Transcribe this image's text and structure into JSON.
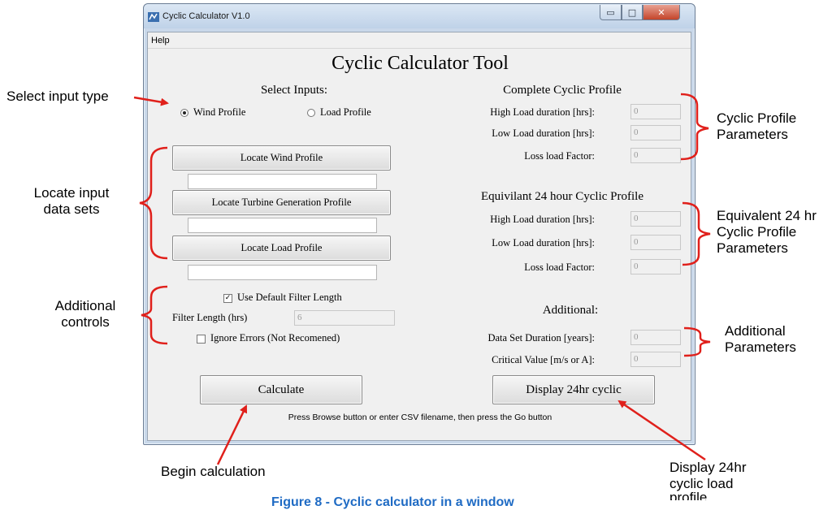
{
  "window": {
    "title": "Cyclic Calculator V1.0",
    "minimize_glyph": "▭",
    "maximize_glyph": "□",
    "close_glyph": "✕"
  },
  "menu": {
    "help": "Help"
  },
  "app_title": "Cyclic Calculator Tool",
  "inputs": {
    "heading": "Select Inputs:",
    "radio_wind": "Wind Profile",
    "radio_load": "Load Profile",
    "selected": "Wind Profile",
    "locate_wind_button": "Locate Wind Profile",
    "wind_path": "",
    "locate_turbine_button": "Locate Turbine Generation Profile",
    "turbine_path": "",
    "locate_load_button": "Locate Load Profile",
    "load_path": ""
  },
  "controls": {
    "use_default_filter_label": "Use Default Filter Length",
    "use_default_filter_checked": true,
    "filter_length_label": "Filter Length (hrs)",
    "filter_length_value": "6",
    "ignore_errors_label": "Ignore Errors (Not Recomened)",
    "ignore_errors_checked": false
  },
  "complete_profile": {
    "heading": "Complete Cyclic Profile",
    "high_label": "High Load duration [hrs]:",
    "high_value": "0",
    "low_label": "Low Load duration [hrs]:",
    "low_value": "0",
    "loss_label": "Loss load Factor:",
    "loss_value": "0"
  },
  "equivalent_profile": {
    "heading": "Equivilant 24 hour Cyclic Profile",
    "high_label": "High Load duration [hrs]:",
    "high_value": "0",
    "low_label": "Low Load duration [hrs]:",
    "low_value": "0",
    "loss_label": "Loss load Factor:",
    "loss_value": "0"
  },
  "additional": {
    "heading": "Additional:",
    "duration_label": "Data Set Duration [years]:",
    "duration_value": "0",
    "critical_label": "Critical Value [m/s or A]:",
    "critical_value": "0"
  },
  "buttons": {
    "calculate": "Calculate",
    "display_24hr": "Display 24hr cyclic"
  },
  "status_text": "Press Browse button or enter CSV filename, then press the Go button",
  "annotations": {
    "select_input_type": "Select input type",
    "locate_input_line1": "Locate input",
    "locate_input_line2": "data sets",
    "additional_controls_line1": "Additional",
    "additional_controls_line2": "controls",
    "begin_calculation": "Begin calculation",
    "cyclic_params_line1": "Cyclic Profile",
    "cyclic_params_line2": "Parameters",
    "equiv_params_line1": "Equivalent 24 hr",
    "equiv_params_line2": "Cyclic Profile",
    "equiv_params_line3": "Parameters",
    "additional_params_line1": "Additional",
    "additional_params_line2": "Parameters",
    "display_line1": "Display 24hr",
    "display_line2": "cyclic load",
    "display_line3": "profile"
  },
  "caption": "Figure 8 - Cyclic calculator in a window",
  "colors": {
    "arrow": "#e0201b",
    "caption": "#1f6bc4",
    "close_button": "#c4442a"
  }
}
